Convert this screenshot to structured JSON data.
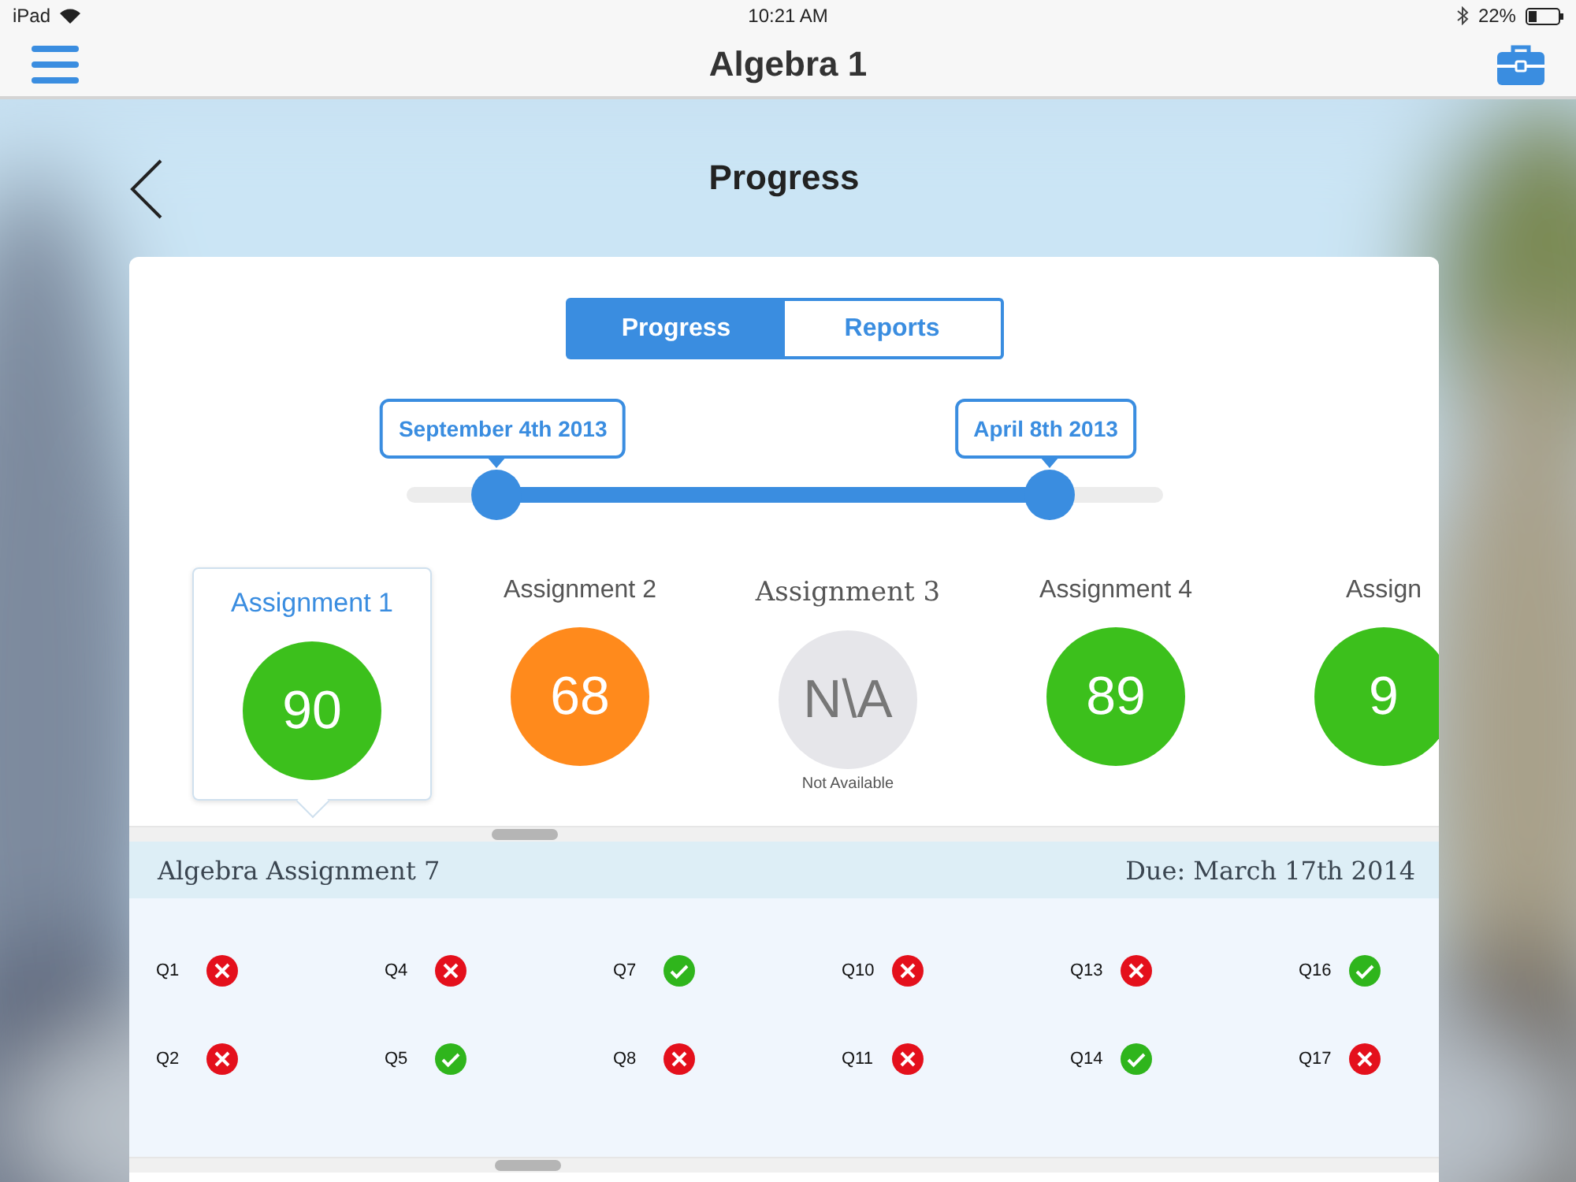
{
  "status_bar": {
    "device": "iPad",
    "time": "10:21 AM",
    "battery": "22%"
  },
  "nav_bar": {
    "title": "Algebra 1"
  },
  "page": {
    "title": "Progress"
  },
  "tabs": [
    {
      "label": "Progress",
      "selected": true
    },
    {
      "label": "Reports",
      "selected": false
    }
  ],
  "date_range": {
    "start_label": "September 4th 2013",
    "end_label": "April 8th 2013",
    "start": {
      "level": 0.12
    },
    "end": {
      "level": 0.85
    }
  },
  "assignments": [
    {
      "label": "Assignment 1",
      "score": "90",
      "color": "#3cc01c",
      "selected": true
    },
    {
      "label": "Assignment 2",
      "score": "68",
      "color": "#ff8a1c",
      "selected": false
    },
    {
      "label": "Assignment 3",
      "score": "N\\A",
      "note": "Not Available",
      "color": "#e6e6ea",
      "selected": false
    },
    {
      "label": "Assignment 4",
      "score": "89",
      "color": "#3cc01c",
      "selected": false
    },
    {
      "label": "Assign",
      "score": "9",
      "color": "#3cc01c",
      "selected": false
    }
  ],
  "detail": {
    "title": "Algebra Assignment 7",
    "due": "Due: March 17th 2014",
    "questions": [
      {
        "label": "Q1",
        "correct": false
      },
      {
        "label": "Q4",
        "correct": false
      },
      {
        "label": "Q7",
        "correct": true
      },
      {
        "label": "Q10",
        "correct": false
      },
      {
        "label": "Q13",
        "correct": false
      },
      {
        "label": "Q16",
        "correct": true
      },
      {
        "label": "Q2",
        "correct": false
      },
      {
        "label": "Q5",
        "correct": true
      },
      {
        "label": "Q8",
        "correct": false
      },
      {
        "label": "Q11",
        "correct": false
      },
      {
        "label": "Q14",
        "correct": true
      },
      {
        "label": "Q17",
        "correct": false
      }
    ]
  }
}
